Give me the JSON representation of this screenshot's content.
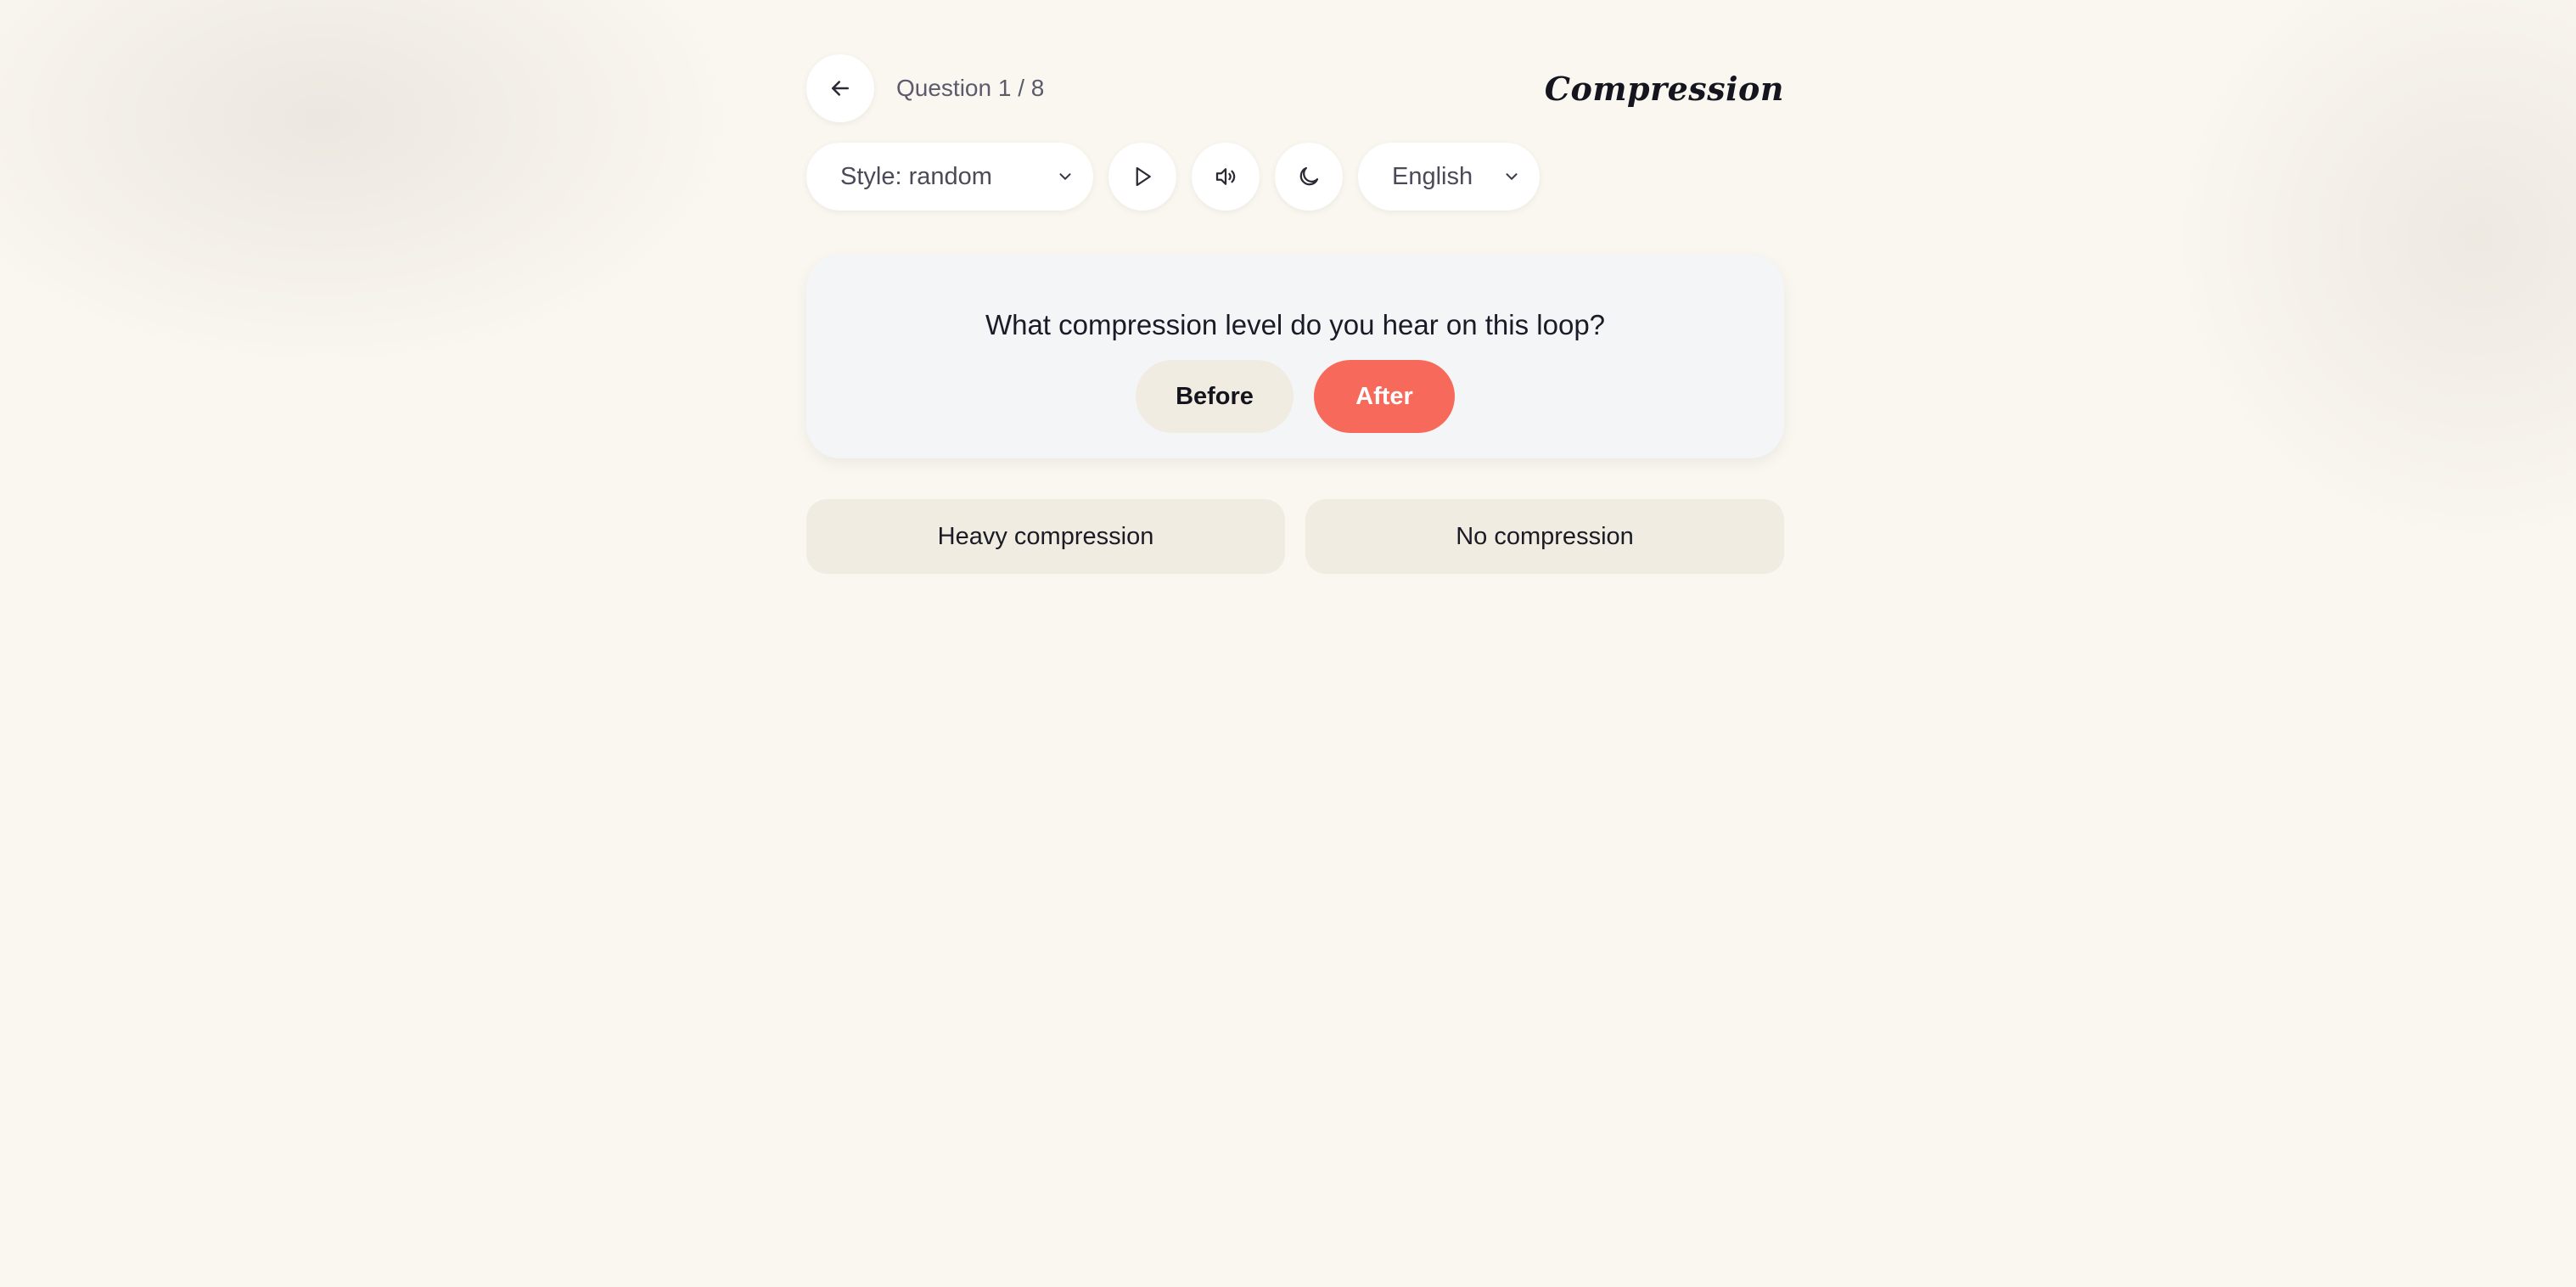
{
  "header": {
    "question_counter": "Question 1 / 8",
    "title": "Compression"
  },
  "toolbar": {
    "style_select": {
      "value": "Style: random"
    },
    "language_select": {
      "value": "English"
    },
    "icons": [
      "arrow-left-icon",
      "play-icon",
      "volume-icon",
      "moon-icon",
      "chevron-down-icon"
    ]
  },
  "quiz": {
    "question": "What compression level do you hear on this loop?",
    "before_label": "Before",
    "after_label": "After",
    "answers": [
      {
        "label": "Heavy compression"
      },
      {
        "label": "No compression"
      }
    ]
  },
  "colors": {
    "accent": "#f76a5b",
    "background": "#faf6f0",
    "pill_beige": "#f1ece2",
    "card": "#f4f5f7"
  }
}
